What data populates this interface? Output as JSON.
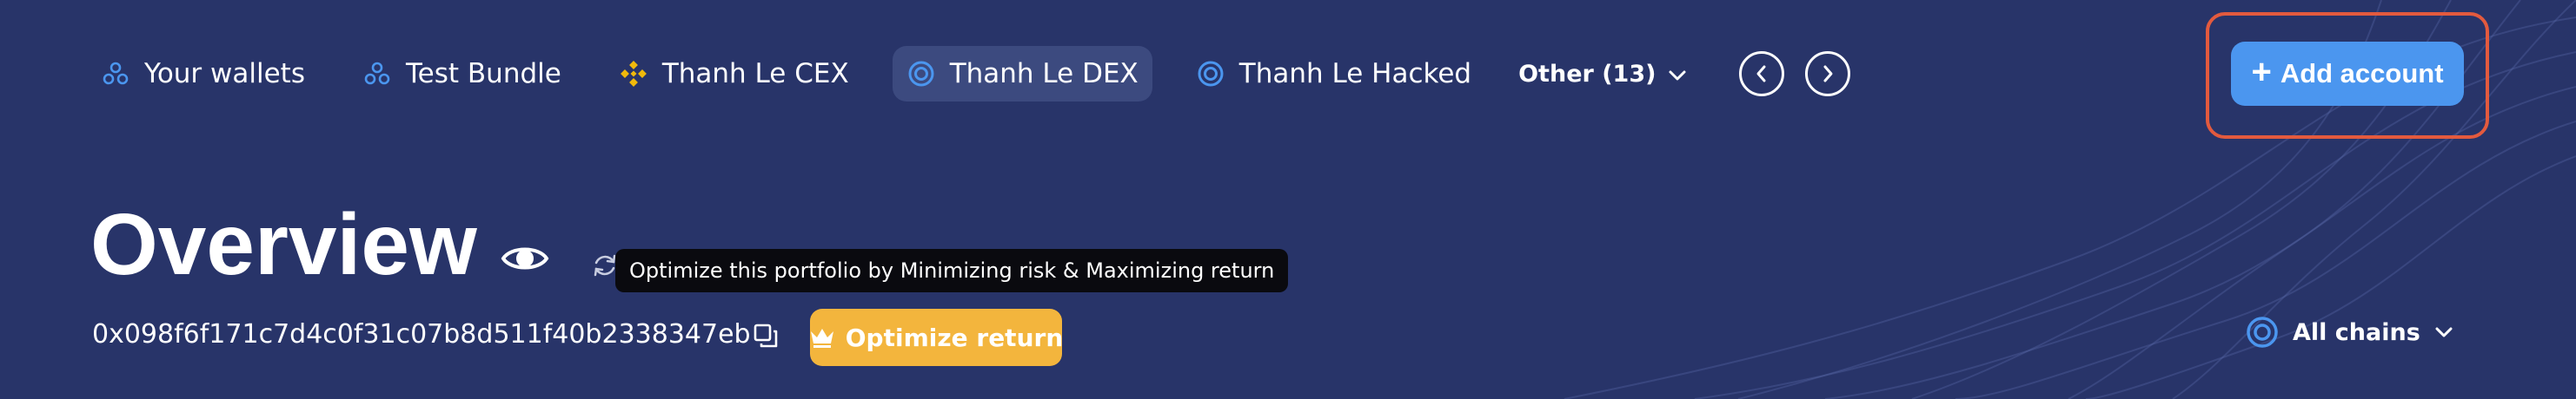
{
  "tabs": [
    {
      "label": "Your wallets",
      "icon": "wallets-icon"
    },
    {
      "label": "Test Bundle",
      "icon": "bundle-icon"
    },
    {
      "label": "Thanh Le CEX",
      "icon": "binance-icon"
    },
    {
      "label": "Thanh Le DEX",
      "icon": "dex-circle-icon",
      "active": true
    },
    {
      "label": "Thanh Le Hacked",
      "icon": "dex-circle-icon"
    }
  ],
  "other_tab": {
    "label": "Other (13)"
  },
  "add_account": {
    "label": "Add account"
  },
  "overview": {
    "title": "Overview",
    "tooltip": "Optimize this portfolio by Minimizing risk & Maximizing return",
    "address": "0x098f6f171c7d4c0f31c07b8d511f40b2338347eb",
    "optimize_label": "Optimize return"
  },
  "chains": {
    "label": "All chains"
  },
  "colors": {
    "background": "#283469",
    "active_tab": "#3c4a7f",
    "accent_blue": "#4b96ef",
    "highlight_outline": "#e35a3e",
    "optimize": "#f3b53d",
    "tooltip_bg": "#0a0a0f",
    "binance_yellow": "#f0b90b"
  }
}
